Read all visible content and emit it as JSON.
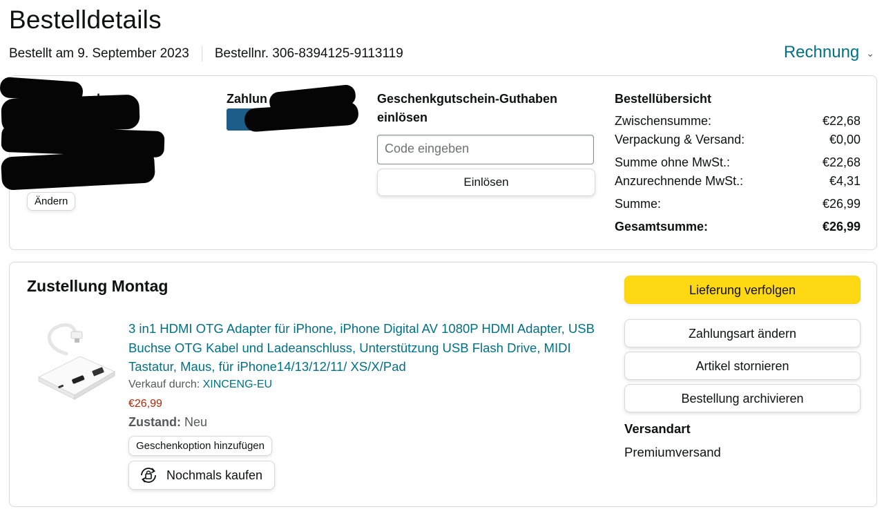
{
  "header": {
    "title": "Bestelldetails",
    "ordered_on": "Bestellt am 9. September 2023",
    "order_number": "Bestellnr. 306-8394125-9113119",
    "invoice_label": "Rechnung"
  },
  "shipping_address": {
    "title_visible": "adresse",
    "change_label": "Ändern"
  },
  "payment": {
    "title_visible": "Zahlun"
  },
  "gift_card": {
    "title": "Geschenkgutschein-Guthaben einlösen",
    "input_placeholder": "Code eingeben",
    "redeem_label": "Einlösen"
  },
  "summary": {
    "title": "Bestellübersicht",
    "rows": [
      {
        "label": "Zwischensumme:",
        "value": "€22,68"
      },
      {
        "label": "Verpackung & Versand:",
        "value": "€0,00"
      },
      {
        "label": "Summe ohne MwSt.:",
        "value": "€22,68"
      },
      {
        "label": "Anzurechnende MwSt.:",
        "value": "€4,31"
      },
      {
        "label": "Summe:",
        "value": "€26,99"
      },
      {
        "label": "Gesamtsumme:",
        "value": "€26,99"
      }
    ]
  },
  "delivery": {
    "title": "Zustellung Montag",
    "product": {
      "title": "3 in1 HDMI OTG Adapter für iPhone, iPhone Digital AV 1080P HDMI Adapter, USB Buchse OTG Kabel und Ladeanschluss, Unterstützung USB Flash Drive, MIDI Tastatur, Maus, für iPhone14/13/12/11/ XS/X/Pad",
      "sold_by_label": "Verkauf durch:",
      "seller": "XINCENG-EU",
      "price": "€26,99",
      "condition_label": "Zustand:",
      "condition_value": "Neu",
      "gift_option_label": "Geschenkoption hinzufügen",
      "buy_again_label": "Nochmals kaufen"
    },
    "actions": {
      "track": "Lieferung verfolgen",
      "change_payment": "Zahlungsart ändern",
      "cancel_items": "Artikel stornieren",
      "archive_order": "Bestellung archivieren"
    },
    "shipping_method_title": "Versandart",
    "shipping_method_value": "Premiumversand"
  },
  "colors": {
    "link": "#007185",
    "primary_button": "#ffd814",
    "price": "#b12704",
    "border": "#d5d9d9"
  }
}
